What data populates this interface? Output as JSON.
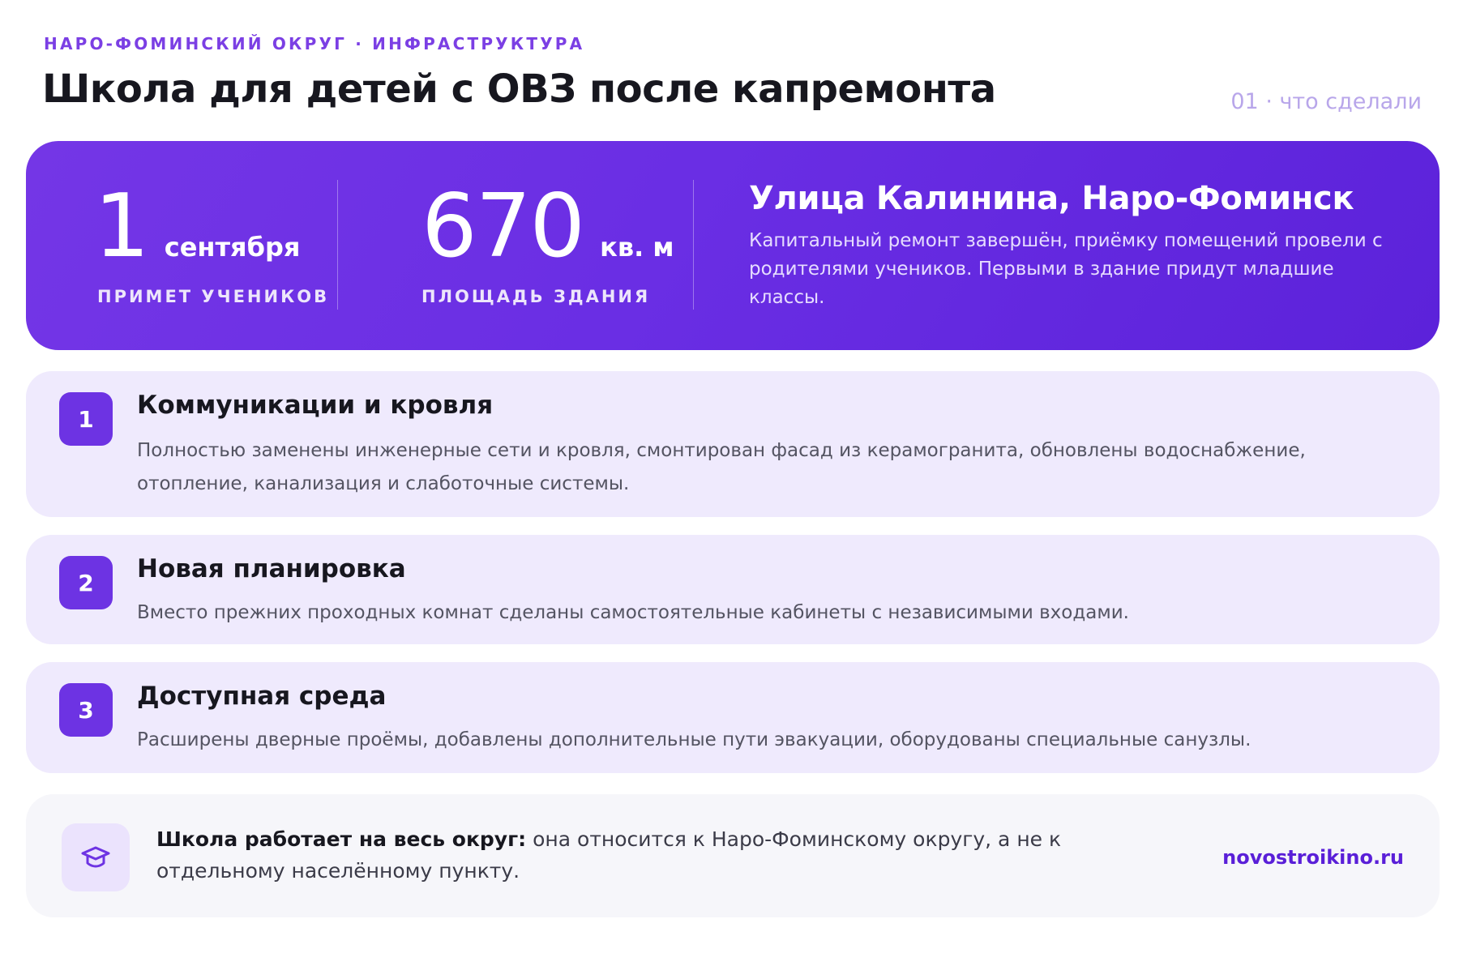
{
  "header": {
    "kicker": "НАРО-ФОМИНСКИЙ ОКРУГ · ИНФРАСТРУКТУРА",
    "title": "Школа для детей с ОВЗ после капремонта",
    "page_indicator": "01 · что сделали"
  },
  "hero": {
    "stats": [
      {
        "value": "1",
        "unit": "сентября",
        "label": "ПРИМЕТ УЧЕНИКОВ"
      },
      {
        "value": "670",
        "unit": "кв. м",
        "label": "ПЛОЩАДЬ ЗДАНИЯ"
      }
    ],
    "heading": "Улица Калинина, Наро-Фоминск",
    "description": "Капитальный ремонт завершён, приёмку помещений провели с родителями учеников. Первыми в здание придут младшие классы."
  },
  "steps": [
    {
      "number": "1",
      "title": "Коммуникации и кровля",
      "description": "Полностью заменены инженерные сети и кровля, смонтирован фасад из керамогранита, обновлены водоснабжение, отопление, канализация и слаботочные системы."
    },
    {
      "number": "2",
      "title": "Новая планировка",
      "description": "Вместо прежних проходных комнат сделаны самостоятельные кабинеты с независимыми входами."
    },
    {
      "number": "3",
      "title": "Доступная среда",
      "description": "Расширены дверные проёмы, добавлены дополнительные пути эвакуации, оборудованы специальные санузлы."
    }
  ],
  "footer": {
    "icon": "graduation-cap-icon",
    "lead": "Школа работает на весь округ:",
    "text": " она относится к Наро-Фоминскому округу, а не к отдельному населённому пункту.",
    "site": "novostroikino.ru"
  },
  "colors": {
    "accent": "#6d33e3",
    "hero_gradient_start": "#7436e6",
    "hero_gradient_end": "#5c22da",
    "step_background": "#efeafd",
    "footer_background": "#f6f6fa"
  }
}
